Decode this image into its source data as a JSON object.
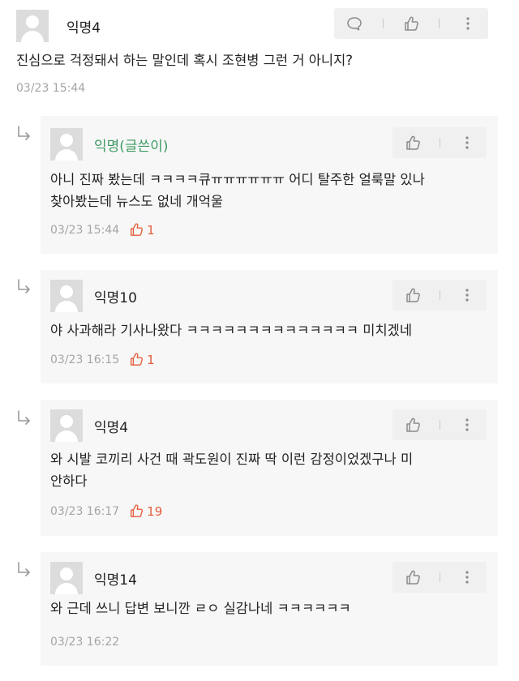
{
  "main_comment": {
    "name": "익명4",
    "text": "진심으로 걱정돼서 하는 말인데 혹시 조현병 그런 거 아니지?",
    "time": "03/23 15:44"
  },
  "replies": [
    {
      "name": "익명(글쓴이)",
      "text_lines": [
        "아니 진짜 봤는데 ㅋㅋㅋㅋ큐ㅠㅠㅠㅠㅠㅠ 어디 탈주한 얼룩말 있나",
        "찾아봤는데 뉴스도 없네 개억울"
      ],
      "time": "03/23 15:44",
      "likes": "1"
    },
    {
      "name": "익명10",
      "text_lines": [
        "야 사과해라 기사나왔다 ㅋㅋㅋㅋㅋㅋㅋㅋㅋㅋㅋㅋㅋㅋ 미치겠네"
      ],
      "time": "03/23 16:15",
      "likes": "1"
    },
    {
      "name": "익명4",
      "text_lines": [
        "와 시발 코끼리 사건 때 곽도원이 진짜 딱 이런 감정이었겠구나 미",
        "안하다"
      ],
      "time": "03/23 16:17",
      "likes": "19"
    },
    {
      "name": "익명14",
      "text_lines": [
        "와 근데 쓰니 답변 보니깐 ㄹㅇ 실감나네 ㅋㅋㅋㅋㅋㅋ"
      ],
      "time": "03/23 16:22",
      "likes": ""
    }
  ],
  "colors": {
    "author": "#3d9a63",
    "like": "#e45c3c",
    "meta": "#a5a5a5",
    "reply_bg": "#f7f7f7",
    "action_bg": "#f0f0f0"
  },
  "icons": {
    "comment": "speech-bubble-icon",
    "like": "thumbs-up-icon",
    "more": "vertical-dots-icon",
    "reply": "reply-arrow-icon"
  }
}
